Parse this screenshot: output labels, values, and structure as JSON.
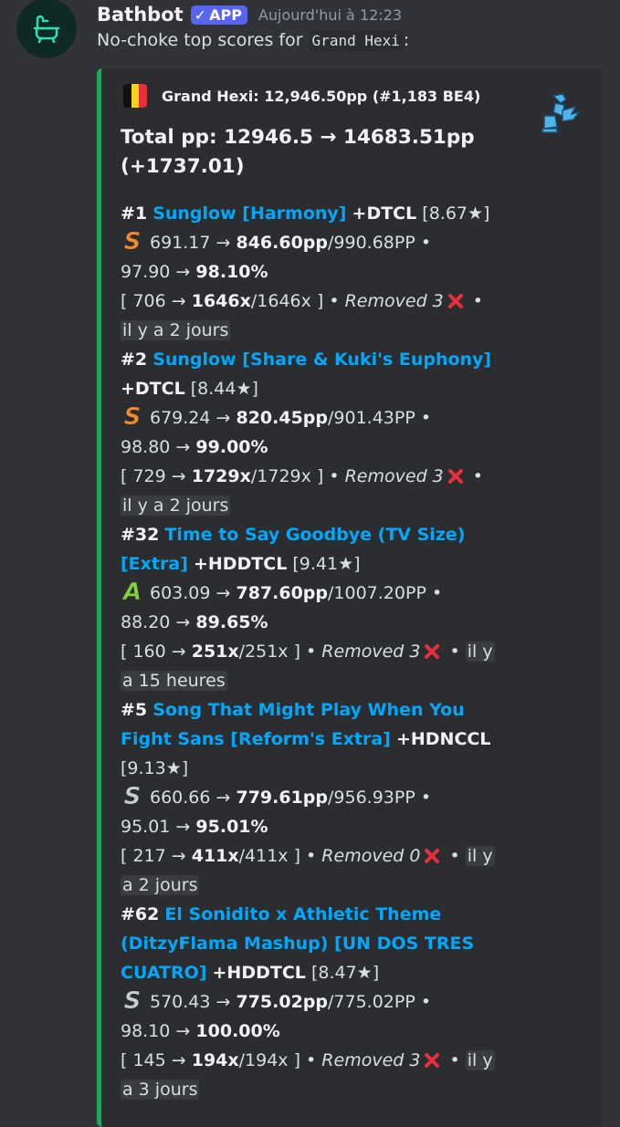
{
  "message": {
    "username": "Bathbot",
    "badge": "APP",
    "badge_check": "✓",
    "timestamp": "Aujourd'hui à 12:23",
    "text_prefix": "No-choke top scores for ",
    "text_code": "Grand Hexi",
    "text_suffix": ":"
  },
  "embed": {
    "accent_color": "#23a55a",
    "author": "Grand Hexi: 12,946.50pp (#1,183 BE4)",
    "title_line1": "Total pp: 12946.5 → ",
    "title_new_pp": "14683.51pp",
    "title_line2": "(+1737.01)",
    "entries": [
      {
        "rank": "#1",
        "title_line_a": "Sunglow [Harmony]",
        "title_line_b": "",
        "title_line_c": "",
        "mods": "+DTCL",
        "stars": "[8.67★]",
        "grade": "S",
        "grade_color": "#f58a2a",
        "pp_old": "691.17 → ",
        "pp_new": "846.60pp",
        "pp_max": "/990.68PP •",
        "acc_old": "97.90 → ",
        "acc_new": "98.10%",
        "combo_old": "[ 706 → ",
        "combo_new": "1646x",
        "combo_max": "/1646x ] •",
        "removed": "Removed 3",
        "time_a": "il y a 2 jours",
        "time_b": ""
      },
      {
        "rank": "#2",
        "title_line_a": "Sunglow [Share & Kuki's Euphony]",
        "title_line_b": "",
        "title_line_c": "",
        "mods": "+DTCL",
        "stars": "[8.44★]",
        "grade": "S",
        "grade_color": "#f58a2a",
        "pp_old": "679.24 → ",
        "pp_new": "820.45pp",
        "pp_max": "/901.43PP •",
        "acc_old": "98.80 → ",
        "acc_new": "99.00%",
        "combo_old": "[ 729 → ",
        "combo_new": "1729x",
        "combo_max": "/1729x ] •",
        "removed": "Removed 3",
        "time_a": "il y a 2 jours",
        "time_b": ""
      },
      {
        "rank": "#32",
        "title_line_a": "Time to Say Goodbye (TV Size)",
        "title_line_b": "[Extra]",
        "title_line_c": "",
        "mods": "+HDDTCL",
        "stars": "[9.41★]",
        "grade": "A",
        "grade_color": "#7fd33a",
        "pp_old": "603.09 → ",
        "pp_new": "787.60pp",
        "pp_max": "/1007.20PP •",
        "acc_old": "88.20 → ",
        "acc_new": "89.65%",
        "combo_old": "[ 160 → ",
        "combo_new": "251x",
        "combo_max": "/251x ] •",
        "removed": "Removed 3",
        "time_a": "il y",
        "time_b": "a 15 heures"
      },
      {
        "rank": "#5",
        "title_line_a": "Song That Might Play When You",
        "title_line_b": "Fight Sans [Reform's Extra]",
        "title_line_c": "",
        "mods": "+HDNCCL",
        "stars": "[9.13★]",
        "grade": "S",
        "grade_color": "#c9ccd1",
        "pp_old": "660.66 → ",
        "pp_new": "779.61pp",
        "pp_max": "/956.93PP •",
        "acc_old": "95.01 → ",
        "acc_new": "95.01%",
        "combo_old": "[ 217 → ",
        "combo_new": "411x",
        "combo_max": "/411x ] •",
        "removed": "Removed 0",
        "time_a": "il y",
        "time_b": "a 2 jours"
      },
      {
        "rank": "#62",
        "title_line_a": "El Sonidito x Athletic Theme",
        "title_line_b": "(DitzyFlama Mashup) [UN DOS TRES",
        "title_line_c": "CUATRO]",
        "mods": "+HDDTCL",
        "stars": "[8.47★]",
        "grade": "S",
        "grade_color": "#c9ccd1",
        "pp_old": "570.43 → ",
        "pp_new": "775.02pp",
        "pp_max": "/775.02PP •",
        "acc_old": "98.10 → ",
        "acc_new": "100.00%",
        "combo_old": "[ 145 → ",
        "combo_new": "194x",
        "combo_max": "/194x ] •",
        "removed": "Removed 3",
        "time_a": "il y",
        "time_b": "a 3 jours"
      }
    ]
  }
}
